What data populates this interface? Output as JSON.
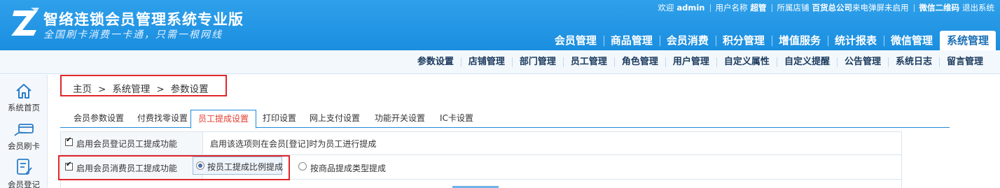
{
  "brand": {
    "title": "智络连锁会员管理系统专业版",
    "slogan": "全国刷卡消费一卡通，只需一根网线"
  },
  "topbar": {
    "welcome": "欢迎",
    "user": "admin",
    "user_name_label": "用户名称",
    "user_name": "超管",
    "store_label": "所属店铺",
    "store": "百货总公司",
    "popup_notice": "来电弹屏未启用",
    "wechat_qr": "微信二维码",
    "logout": "退出系统"
  },
  "main_nav": [
    {
      "label": "会员管理",
      "active": false
    },
    {
      "label": "商品管理",
      "active": false
    },
    {
      "label": "会员消费",
      "active": false
    },
    {
      "label": "积分管理",
      "active": false
    },
    {
      "label": "增值服务",
      "active": false
    },
    {
      "label": "统计报表",
      "active": false
    },
    {
      "label": "微信管理",
      "active": false
    },
    {
      "label": "系统管理",
      "active": true
    }
  ],
  "sub_nav": [
    "参数设置",
    "店铺管理",
    "部门管理",
    "员工管理",
    "角色管理",
    "用户管理",
    "自定义属性",
    "自定义提醒",
    "公告管理",
    "系统日志",
    "留言管理"
  ],
  "sidebar": [
    {
      "label": "系统首页",
      "icon": "home-icon"
    },
    {
      "label": "会员刷卡",
      "icon": "card-swipe-icon"
    },
    {
      "label": "会员登记",
      "icon": "register-icon"
    }
  ],
  "breadcrumb": {
    "home": "主页",
    "level1": "系统管理",
    "level2": "参数设置",
    "separator": ">"
  },
  "tabs": [
    {
      "label": "会员参数设置",
      "active": false
    },
    {
      "label": "付费找零设置",
      "active": false
    },
    {
      "label": "员工提成设置",
      "active": true
    },
    {
      "label": "打印设置",
      "active": false
    },
    {
      "label": "网上支付设置",
      "active": false
    },
    {
      "label": "功能开关设置",
      "active": false
    },
    {
      "label": "IC卡设置",
      "active": false
    }
  ],
  "settings": {
    "register_commission": {
      "label": "启用会员登记员工提成功能",
      "checked": true,
      "description": "启用该选项则在会员[登记]时为员工进行提成"
    },
    "consume_commission": {
      "label": "启用会员消费员工提成功能",
      "checked": true,
      "options": [
        {
          "label": "按员工提成比例提成",
          "selected": true
        },
        {
          "label": "按商品提成类型提成",
          "selected": false
        }
      ]
    }
  },
  "colors": {
    "header_blue": "#1a8ee0",
    "active_tab_text": "#e53c2f",
    "highlight_red": "#e0262a"
  }
}
